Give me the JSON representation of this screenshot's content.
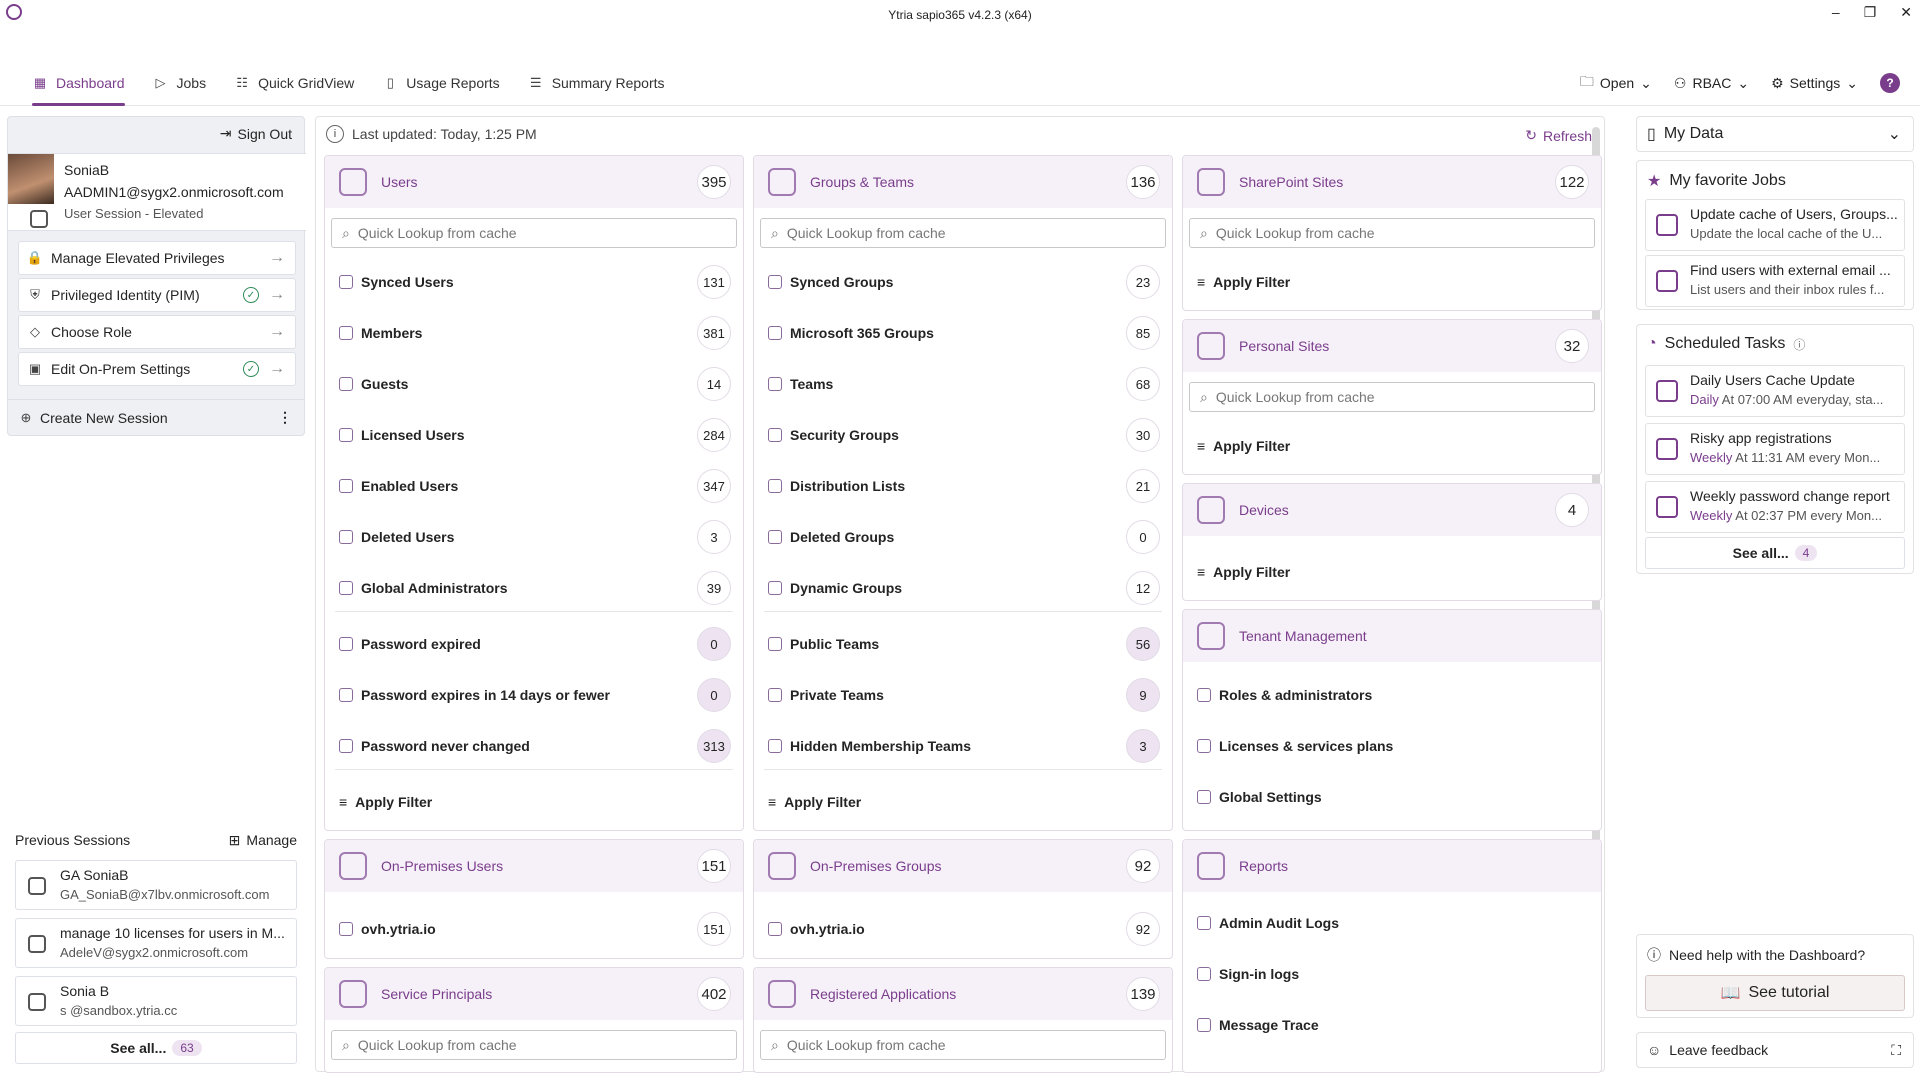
{
  "window": {
    "title": "Ytria sapio365 v4.2.3 (x64)"
  },
  "tabs": [
    "Dashboard",
    "Jobs",
    "Quick GridView",
    "Usage Reports",
    "Summary Reports"
  ],
  "toolbar": {
    "open": "Open",
    "rbac": "RBAC",
    "settings": "Settings",
    "help": "?"
  },
  "session": {
    "signout": "Sign Out",
    "name": "SoniaB",
    "email": "AADMIN1@sygx2.onmicrosoft.com",
    "status": "User Session - Elevated",
    "actions": [
      "Manage Elevated Privileges",
      "Privileged Identity (PIM)",
      "Choose Role",
      "Edit On-Prem Settings"
    ],
    "create": "Create New Session"
  },
  "previous": {
    "title": "Previous Sessions",
    "manage": "Manage",
    "items": [
      {
        "name": "GA SoniaB",
        "email": "GA_SoniaB@x7lbv.onmicrosoft.com"
      },
      {
        "name": "manage 10 licenses for users in M...",
        "email": "AdeleV@sygx2.onmicrosoft.com"
      },
      {
        "name": "Sonia B",
        "email": "s          @sandbox.ytria.cc"
      }
    ],
    "see_all": "See all...",
    "count": "63"
  },
  "main": {
    "last_updated": "Last updated: Today, 1:25 PM",
    "refresh": "Refresh",
    "lookup": "Quick Lookup from cache",
    "apply": "Apply Filter"
  },
  "users": {
    "title": "Users",
    "count": "395",
    "rows": [
      [
        "Synced Users",
        "131"
      ],
      [
        "Members",
        "381"
      ],
      [
        "Guests",
        "14"
      ],
      [
        "Licensed Users",
        "284"
      ],
      [
        "Enabled Users",
        "347"
      ],
      [
        "Deleted Users",
        "3"
      ],
      [
        "Global Administrators",
        "39"
      ],
      [
        "Password expired",
        "0"
      ],
      [
        "Password expires in 14 days or fewer",
        "0"
      ],
      [
        "Password never changed",
        "313"
      ]
    ]
  },
  "groups": {
    "title": "Groups & Teams",
    "count": "136",
    "rows": [
      [
        "Synced Groups",
        "23"
      ],
      [
        "Microsoft 365 Groups",
        "85"
      ],
      [
        "Teams",
        "68"
      ],
      [
        "Security Groups",
        "30"
      ],
      [
        "Distribution Lists",
        "21"
      ],
      [
        "Deleted Groups",
        "0"
      ],
      [
        "Dynamic Groups",
        "12"
      ],
      [
        "Public Teams",
        "56"
      ],
      [
        "Private Teams",
        "9"
      ],
      [
        "Hidden Membership Teams",
        "3"
      ]
    ]
  },
  "sharepoint": {
    "title": "SharePoint Sites",
    "count": "122"
  },
  "personal": {
    "title": "Personal Sites",
    "count": "32"
  },
  "devices": {
    "title": "Devices",
    "count": "4"
  },
  "tenant": {
    "title": "Tenant Management",
    "rows": [
      "Roles & administrators",
      "Licenses & services plans",
      "Global Settings"
    ]
  },
  "onpremusers": {
    "title": "On-Premises Users",
    "count": "151",
    "row": "ovh.ytria.io",
    "rcount": "151"
  },
  "onpremgroups": {
    "title": "On-Premises Groups",
    "count": "92",
    "row": "ovh.ytria.io",
    "rcount": "92"
  },
  "reports": {
    "title": "Reports",
    "rows": [
      "Admin Audit Logs",
      "Sign-in logs",
      "Message Trace"
    ]
  },
  "sp": {
    "title": "Service Principals",
    "count": "402"
  },
  "apps": {
    "title": "Registered Applications",
    "count": "139"
  },
  "right": {
    "mydata": "My Data",
    "fav": "My favorite Jobs",
    "jobs": [
      {
        "t": "Update cache of Users, Groups...",
        "d": "Update the local cache of the U..."
      },
      {
        "t": "Find users with external email ...",
        "d": "List users and their inbox rules f..."
      }
    ],
    "sched": "Scheduled Tasks",
    "tasks": [
      {
        "t": "Daily Users Cache Update",
        "f": "Daily",
        "d": " At 07:00 AM everyday, sta..."
      },
      {
        "t": "Risky app registrations",
        "f": "Weekly",
        "d": " At 11:31 AM every Mon..."
      },
      {
        "t": "Weekly password change report",
        "f": "Weekly",
        "d": " At 02:37 PM every Mon..."
      }
    ],
    "see_all": "See all...",
    "count": "4",
    "help": "Need help with the Dashboard?",
    "tutorial": "See tutorial",
    "feedback": "Leave feedback"
  },
  "colors": {
    "accent": "#7a3d8c"
  }
}
